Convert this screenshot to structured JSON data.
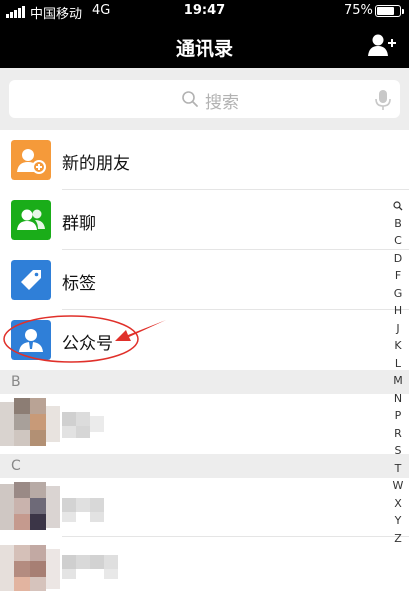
{
  "status_bar": {
    "carrier": "中国移动",
    "network": "4G",
    "time": "19:47",
    "battery": "75%",
    "battery_level": 0.75
  },
  "nav": {
    "title": "通讯录"
  },
  "search": {
    "placeholder": "搜索"
  },
  "menu": [
    {
      "label": "新的朋友",
      "color": "#f59a3a",
      "icon": "new-friends-icon"
    },
    {
      "label": "群聊",
      "color": "#1aad19",
      "icon": "group-chat-icon"
    },
    {
      "label": "标签",
      "color": "#2f7fd8",
      "icon": "tag-icon"
    },
    {
      "label": "公众号",
      "color": "#2f7fd8",
      "icon": "official-account-icon"
    }
  ],
  "sections": {
    "b": "B",
    "c": "C"
  },
  "index_letters": [
    "B",
    "C",
    "D",
    "F",
    "G",
    "H",
    "J",
    "K",
    "L",
    "M",
    "N",
    "P",
    "R",
    "S",
    "T",
    "W",
    "X",
    "Y",
    "Z"
  ],
  "colors": {
    "accent": "#1aad19",
    "annotation": "#e0302a"
  }
}
